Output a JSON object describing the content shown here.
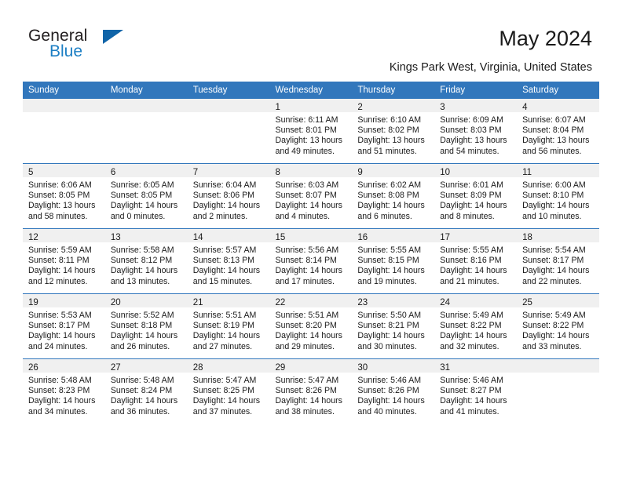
{
  "brand": {
    "name_part1": "General",
    "name_part2": "Blue",
    "accent_color": "#1064a8",
    "blue_text_color": "#1d7fc4"
  },
  "header": {
    "title": "May 2024",
    "location": "Kings Park West, Virginia, United States"
  },
  "calendar": {
    "header_bg": "#3277bc",
    "daynum_band_bg": "#f0f0f0",
    "weekdays": [
      "Sunday",
      "Monday",
      "Tuesday",
      "Wednesday",
      "Thursday",
      "Friday",
      "Saturday"
    ],
    "weeks": [
      [
        {
          "empty": true
        },
        {
          "empty": true
        },
        {
          "empty": true
        },
        {
          "day": "1",
          "sunrise": "Sunrise: 6:11 AM",
          "sunset": "Sunset: 8:01 PM",
          "daylight1": "Daylight: 13 hours",
          "daylight2": "and 49 minutes."
        },
        {
          "day": "2",
          "sunrise": "Sunrise: 6:10 AM",
          "sunset": "Sunset: 8:02 PM",
          "daylight1": "Daylight: 13 hours",
          "daylight2": "and 51 minutes."
        },
        {
          "day": "3",
          "sunrise": "Sunrise: 6:09 AM",
          "sunset": "Sunset: 8:03 PM",
          "daylight1": "Daylight: 13 hours",
          "daylight2": "and 54 minutes."
        },
        {
          "day": "4",
          "sunrise": "Sunrise: 6:07 AM",
          "sunset": "Sunset: 8:04 PM",
          "daylight1": "Daylight: 13 hours",
          "daylight2": "and 56 minutes."
        }
      ],
      [
        {
          "day": "5",
          "sunrise": "Sunrise: 6:06 AM",
          "sunset": "Sunset: 8:05 PM",
          "daylight1": "Daylight: 13 hours",
          "daylight2": "and 58 minutes."
        },
        {
          "day": "6",
          "sunrise": "Sunrise: 6:05 AM",
          "sunset": "Sunset: 8:05 PM",
          "daylight1": "Daylight: 14 hours",
          "daylight2": "and 0 minutes."
        },
        {
          "day": "7",
          "sunrise": "Sunrise: 6:04 AM",
          "sunset": "Sunset: 8:06 PM",
          "daylight1": "Daylight: 14 hours",
          "daylight2": "and 2 minutes."
        },
        {
          "day": "8",
          "sunrise": "Sunrise: 6:03 AM",
          "sunset": "Sunset: 8:07 PM",
          "daylight1": "Daylight: 14 hours",
          "daylight2": "and 4 minutes."
        },
        {
          "day": "9",
          "sunrise": "Sunrise: 6:02 AM",
          "sunset": "Sunset: 8:08 PM",
          "daylight1": "Daylight: 14 hours",
          "daylight2": "and 6 minutes."
        },
        {
          "day": "10",
          "sunrise": "Sunrise: 6:01 AM",
          "sunset": "Sunset: 8:09 PM",
          "daylight1": "Daylight: 14 hours",
          "daylight2": "and 8 minutes."
        },
        {
          "day": "11",
          "sunrise": "Sunrise: 6:00 AM",
          "sunset": "Sunset: 8:10 PM",
          "daylight1": "Daylight: 14 hours",
          "daylight2": "and 10 minutes."
        }
      ],
      [
        {
          "day": "12",
          "sunrise": "Sunrise: 5:59 AM",
          "sunset": "Sunset: 8:11 PM",
          "daylight1": "Daylight: 14 hours",
          "daylight2": "and 12 minutes."
        },
        {
          "day": "13",
          "sunrise": "Sunrise: 5:58 AM",
          "sunset": "Sunset: 8:12 PM",
          "daylight1": "Daylight: 14 hours",
          "daylight2": "and 13 minutes."
        },
        {
          "day": "14",
          "sunrise": "Sunrise: 5:57 AM",
          "sunset": "Sunset: 8:13 PM",
          "daylight1": "Daylight: 14 hours",
          "daylight2": "and 15 minutes."
        },
        {
          "day": "15",
          "sunrise": "Sunrise: 5:56 AM",
          "sunset": "Sunset: 8:14 PM",
          "daylight1": "Daylight: 14 hours",
          "daylight2": "and 17 minutes."
        },
        {
          "day": "16",
          "sunrise": "Sunrise: 5:55 AM",
          "sunset": "Sunset: 8:15 PM",
          "daylight1": "Daylight: 14 hours",
          "daylight2": "and 19 minutes."
        },
        {
          "day": "17",
          "sunrise": "Sunrise: 5:55 AM",
          "sunset": "Sunset: 8:16 PM",
          "daylight1": "Daylight: 14 hours",
          "daylight2": "and 21 minutes."
        },
        {
          "day": "18",
          "sunrise": "Sunrise: 5:54 AM",
          "sunset": "Sunset: 8:17 PM",
          "daylight1": "Daylight: 14 hours",
          "daylight2": "and 22 minutes."
        }
      ],
      [
        {
          "day": "19",
          "sunrise": "Sunrise: 5:53 AM",
          "sunset": "Sunset: 8:17 PM",
          "daylight1": "Daylight: 14 hours",
          "daylight2": "and 24 minutes."
        },
        {
          "day": "20",
          "sunrise": "Sunrise: 5:52 AM",
          "sunset": "Sunset: 8:18 PM",
          "daylight1": "Daylight: 14 hours",
          "daylight2": "and 26 minutes."
        },
        {
          "day": "21",
          "sunrise": "Sunrise: 5:51 AM",
          "sunset": "Sunset: 8:19 PM",
          "daylight1": "Daylight: 14 hours",
          "daylight2": "and 27 minutes."
        },
        {
          "day": "22",
          "sunrise": "Sunrise: 5:51 AM",
          "sunset": "Sunset: 8:20 PM",
          "daylight1": "Daylight: 14 hours",
          "daylight2": "and 29 minutes."
        },
        {
          "day": "23",
          "sunrise": "Sunrise: 5:50 AM",
          "sunset": "Sunset: 8:21 PM",
          "daylight1": "Daylight: 14 hours",
          "daylight2": "and 30 minutes."
        },
        {
          "day": "24",
          "sunrise": "Sunrise: 5:49 AM",
          "sunset": "Sunset: 8:22 PM",
          "daylight1": "Daylight: 14 hours",
          "daylight2": "and 32 minutes."
        },
        {
          "day": "25",
          "sunrise": "Sunrise: 5:49 AM",
          "sunset": "Sunset: 8:22 PM",
          "daylight1": "Daylight: 14 hours",
          "daylight2": "and 33 minutes."
        }
      ],
      [
        {
          "day": "26",
          "sunrise": "Sunrise: 5:48 AM",
          "sunset": "Sunset: 8:23 PM",
          "daylight1": "Daylight: 14 hours",
          "daylight2": "and 34 minutes."
        },
        {
          "day": "27",
          "sunrise": "Sunrise: 5:48 AM",
          "sunset": "Sunset: 8:24 PM",
          "daylight1": "Daylight: 14 hours",
          "daylight2": "and 36 minutes."
        },
        {
          "day": "28",
          "sunrise": "Sunrise: 5:47 AM",
          "sunset": "Sunset: 8:25 PM",
          "daylight1": "Daylight: 14 hours",
          "daylight2": "and 37 minutes."
        },
        {
          "day": "29",
          "sunrise": "Sunrise: 5:47 AM",
          "sunset": "Sunset: 8:26 PM",
          "daylight1": "Daylight: 14 hours",
          "daylight2": "and 38 minutes."
        },
        {
          "day": "30",
          "sunrise": "Sunrise: 5:46 AM",
          "sunset": "Sunset: 8:26 PM",
          "daylight1": "Daylight: 14 hours",
          "daylight2": "and 40 minutes."
        },
        {
          "day": "31",
          "sunrise": "Sunrise: 5:46 AM",
          "sunset": "Sunset: 8:27 PM",
          "daylight1": "Daylight: 14 hours",
          "daylight2": "and 41 minutes."
        },
        {
          "empty": true
        }
      ]
    ]
  }
}
